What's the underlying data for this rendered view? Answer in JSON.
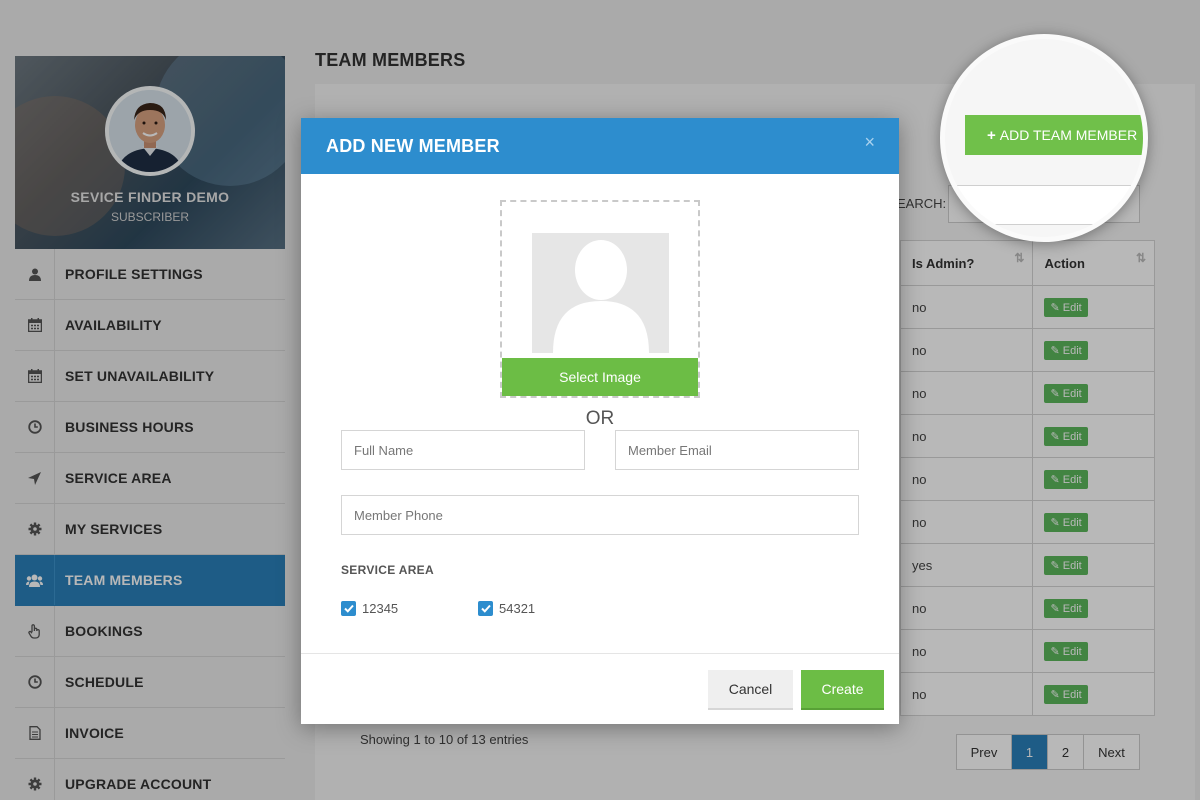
{
  "profile": {
    "name": "SEVICE FINDER DEMO",
    "role": "SUBSCRIBER"
  },
  "sidebar": {
    "items": [
      {
        "label": "PROFILE SETTINGS",
        "icon": "user-icon"
      },
      {
        "label": "AVAILABILITY",
        "icon": "calendar-icon"
      },
      {
        "label": "SET UNAVAILABILITY",
        "icon": "calendar-icon"
      },
      {
        "label": "BUSINESS HOURS",
        "icon": "clock-icon"
      },
      {
        "label": "SERVICE AREA",
        "icon": "location-arrow-icon"
      },
      {
        "label": "MY SERVICES",
        "icon": "gear-icon"
      },
      {
        "label": "TEAM MEMBERS",
        "icon": "users-icon",
        "active": true
      },
      {
        "label": "BOOKINGS",
        "icon": "hand-pointer-icon"
      },
      {
        "label": "SCHEDULE",
        "icon": "clock-icon"
      },
      {
        "label": "INVOICE",
        "icon": "document-icon"
      },
      {
        "label": "UPGRADE ACCOUNT",
        "icon": "gear-icon"
      }
    ]
  },
  "main": {
    "title": "TEAM MEMBERS",
    "add_button_label": "ADD TEAM MEMBER",
    "search_label": "EARCH:",
    "table": {
      "headers": [
        "Is Admin?",
        "Action"
      ],
      "rows": [
        {
          "is_admin": "no",
          "action": "Edit"
        },
        {
          "is_admin": "no",
          "action": "Edit"
        },
        {
          "is_admin": "no",
          "action": "Edit"
        },
        {
          "is_admin": "no",
          "action": "Edit"
        },
        {
          "is_admin": "no",
          "action": "Edit"
        },
        {
          "is_admin": "no",
          "action": "Edit"
        },
        {
          "is_admin": "yes",
          "action": "Edit"
        },
        {
          "is_admin": "no",
          "action": "Edit"
        },
        {
          "is_admin": "no",
          "action": "Edit"
        },
        {
          "is_admin": "no",
          "action": "Edit"
        }
      ]
    },
    "showing": "Showing 1 to 10 of 13 entries",
    "pagination": {
      "prev": "Prev",
      "pages": [
        "1",
        "2"
      ],
      "next": "Next",
      "active": "1"
    }
  },
  "modal": {
    "title": "ADD NEW MEMBER",
    "close": "×",
    "select_image": "Select Image",
    "or": "OR",
    "full_name_placeholder": "Full Name",
    "email_placeholder": "Member Email",
    "phone_placeholder": "Member Phone",
    "service_area_label": "SERVICE AREA",
    "service_areas": [
      {
        "label": "12345",
        "checked": true
      },
      {
        "label": "54321",
        "checked": true
      }
    ],
    "cancel": "Cancel",
    "create": "Create"
  },
  "colors": {
    "accent_blue": "#2d8dce",
    "active_nav": "#2a80ba",
    "green": "#6cbd45"
  }
}
